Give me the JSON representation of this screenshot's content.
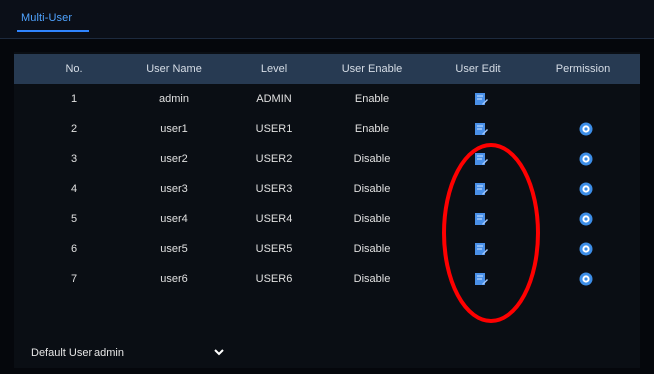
{
  "tabs": [
    {
      "label": "Multi-User",
      "active": true
    }
  ],
  "table": {
    "headers": [
      "No.",
      "User Name",
      "Level",
      "User Enable",
      "User Edit",
      "Permission"
    ],
    "rows": [
      {
        "no": "1",
        "user": "admin",
        "level": "ADMIN",
        "enable": "Enable",
        "edit": true,
        "permission": false
      },
      {
        "no": "2",
        "user": "user1",
        "level": "USER1",
        "enable": "Enable",
        "edit": true,
        "permission": true
      },
      {
        "no": "3",
        "user": "user2",
        "level": "USER2",
        "enable": "Disable",
        "edit": true,
        "permission": true
      },
      {
        "no": "4",
        "user": "user3",
        "level": "USER3",
        "enable": "Disable",
        "edit": true,
        "permission": true
      },
      {
        "no": "5",
        "user": "user4",
        "level": "USER4",
        "enable": "Disable",
        "edit": true,
        "permission": true
      },
      {
        "no": "6",
        "user": "user5",
        "level": "USER5",
        "enable": "Disable",
        "edit": true,
        "permission": true
      },
      {
        "no": "7",
        "user": "user6",
        "level": "USER6",
        "enable": "Disable",
        "edit": true,
        "permission": true
      }
    ]
  },
  "footer": {
    "default_user_label": "Default User",
    "default_user_value": "admin"
  },
  "colors": {
    "accent": "#2f84ff",
    "header_bg": "#273a52",
    "annotation": "#ff0000"
  },
  "icons": {
    "edit": "edit-icon",
    "permission": "gear-icon",
    "dropdown": "chevron-down-icon"
  }
}
